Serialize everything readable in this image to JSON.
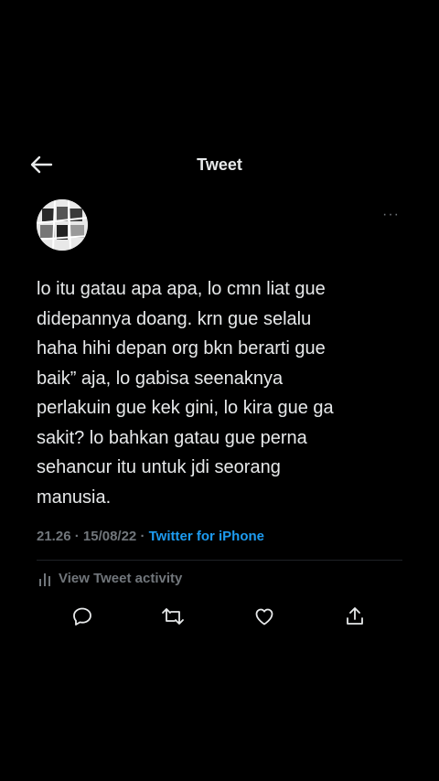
{
  "header": {
    "title": "Tweet",
    "back_icon": "arrow-left-icon"
  },
  "tweet": {
    "text": "lo itu gatau apa apa, lo cmn liat gue\ndidepannya doang. krn gue selalu\nhaha hihi depan org bkn berarti gue\nbaik” aja, lo gabisa seenaknya\nperlakuin gue kek gini, lo kira gue ga\nsakit? lo bahkan gatau gue perna\nsehancur itu untuk jdi seorang\nmanusia.",
    "time": "21.26",
    "separator": "·",
    "date": "15/08/22",
    "source": "Twitter for iPhone",
    "more_icon": "···"
  },
  "activity": {
    "label": "View Tweet activity",
    "icon": "bar-chart-icon"
  },
  "actions": [
    {
      "name": "reply",
      "icon": "reply-icon"
    },
    {
      "name": "retweet",
      "icon": "retweet-icon"
    },
    {
      "name": "like",
      "icon": "heart-icon"
    },
    {
      "name": "share",
      "icon": "share-icon"
    }
  ],
  "colors": {
    "background": "#000000",
    "text": "#e7e9ea",
    "muted": "#71767b",
    "accent": "#1d9bf0"
  }
}
